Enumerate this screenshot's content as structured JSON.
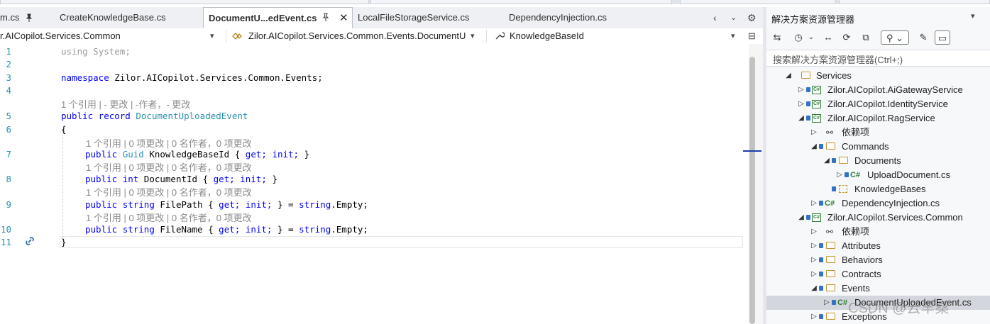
{
  "tabs": [
    {
      "label": "m.cs"
    },
    {
      "label": "CreateKnowledgeBase.cs"
    },
    {
      "label": "DocumentU...edEvent.cs"
    },
    {
      "label": "LocalFileStorageService.cs"
    },
    {
      "label": "DependencyInjection.cs"
    }
  ],
  "tab_icons": {
    "pin": "pin-icon",
    "close": "close-icon",
    "overflow": "chevron-left-icon",
    "settings": "gear-icon"
  },
  "navbar": {
    "project": "r.AICopilot.Services.Common",
    "type": "Zilor.AICopilot.Services.Common.Events.DocumentUp",
    "member": "KnowledgeBaseId"
  },
  "code": {
    "line_numbers": [
      "1",
      "2",
      "3",
      "4",
      "5",
      "6",
      "7",
      "8",
      "9",
      "10",
      "11"
    ],
    "using_kw": "using",
    "using_ns": "System;",
    "ns_kw": "namespace",
    "ns_name": "Zilor.AICopilot.Services.Common.Events;",
    "lens_type": "1 个引用 | - 更改 | -作者，- 更改",
    "record_mods": "public record",
    "record_name": "DocumentUploadedEvent",
    "open_brace": "{",
    "close_brace": "}",
    "lens_prop": "1 个引用 | 0 项更改 | 0 名作者，0 项更改",
    "p1_mods": "public",
    "p1_type": "Guid",
    "p1_name": "KnowledgeBaseId {",
    "p2_mods": "public",
    "p2_type": "int",
    "p2_name": "DocumentId {",
    "p3_mods": "public",
    "p3_type": "string",
    "p3_name": "FilePath {",
    "p4_mods": "public",
    "p4_type": "string",
    "p4_name": "FileName {",
    "accessor_get": "get;",
    "accessor_init": "init;",
    "end_auto": "}",
    "end_init": "} =",
    "str_kw": "string",
    "str_empty": ".Empty;"
  },
  "solution_explorer": {
    "title": "解决方案资源管理器",
    "search_placeholder": "搜索解决方案资源管理器(Ctrl+;)",
    "tree": [
      {
        "label": "Services"
      },
      {
        "label": "Zilor.AICopilot.AiGatewayService"
      },
      {
        "label": "Zilor.AICopilot.IdentityService"
      },
      {
        "label": "Zilor.AICopilot.RagService"
      },
      {
        "label": "依赖项"
      },
      {
        "label": "Commands"
      },
      {
        "label": "Documents"
      },
      {
        "label": "UploadDocument.cs"
      },
      {
        "label": "KnowledgeBases"
      },
      {
        "label": "DependencyInjection.cs"
      },
      {
        "label": "Zilor.AICopilot.Services.Common"
      },
      {
        "label": "依赖项"
      },
      {
        "label": "Attributes"
      },
      {
        "label": "Behaviors"
      },
      {
        "label": "Contracts"
      },
      {
        "label": "Events"
      },
      {
        "label": "DocumentUploadedEvent.cs"
      },
      {
        "label": "Exceptions"
      }
    ]
  },
  "watermark": "CSDN @云羊桑"
}
